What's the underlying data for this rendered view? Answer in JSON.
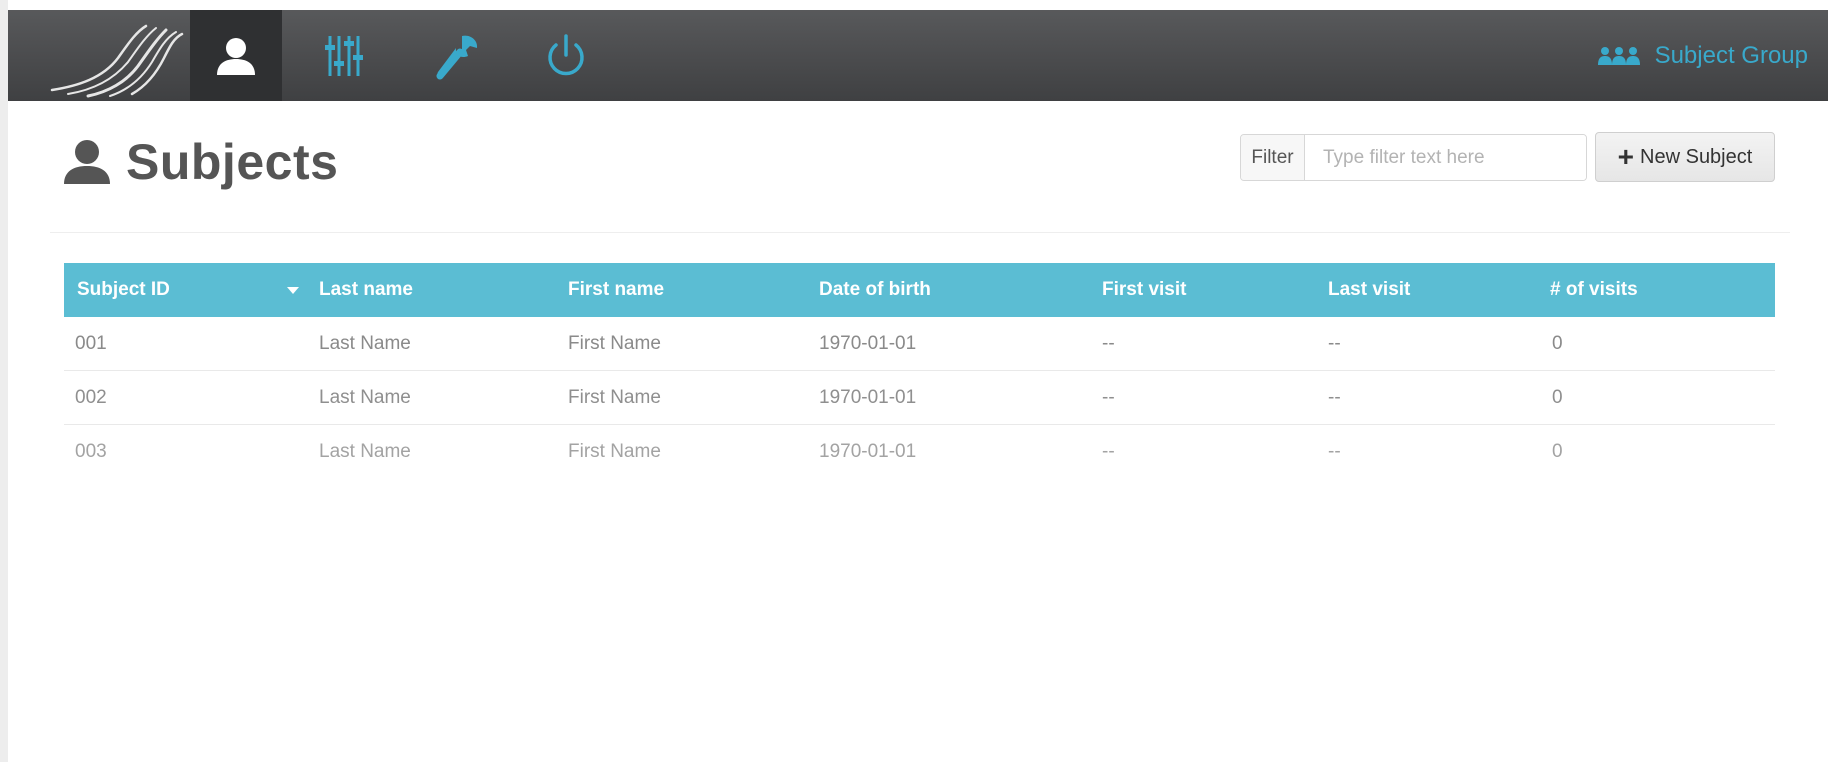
{
  "navbar": {
    "items": [
      {
        "name": "subjects",
        "icon": "user-icon",
        "active": true
      },
      {
        "name": "settings",
        "icon": "sliders-icon",
        "active": false
      },
      {
        "name": "tools",
        "icon": "wrench-icon",
        "active": false
      },
      {
        "name": "power",
        "icon": "power-icon",
        "active": false
      }
    ],
    "group_label": "Subject Group",
    "group_icon": "users-group-icon"
  },
  "page": {
    "title": "Subjects",
    "title_icon": "user-icon"
  },
  "filter": {
    "label": "Filter",
    "placeholder": "Type filter text here",
    "value": ""
  },
  "new_subject_button": {
    "plus": "+",
    "label": "New Subject"
  },
  "table": {
    "sorted_column": "Subject ID",
    "sort_direction": "descending",
    "columns": [
      "Subject ID",
      "Last name",
      "First name",
      "Date of birth",
      "First visit",
      "Last visit",
      "# of visits"
    ],
    "rows": [
      [
        "001",
        "Last Name",
        "First Name",
        "1970-01-01",
        "--",
        "--",
        "0"
      ],
      [
        "002",
        "Last Name",
        "First Name",
        "1970-01-01",
        "--",
        "--",
        "0"
      ],
      [
        "003",
        "Last Name",
        "First Name",
        "1970-01-01",
        "--",
        "--",
        "0"
      ]
    ]
  },
  "colors": {
    "navbar": "#4a4b4d",
    "accent": "#39a9cb",
    "table_header": "#5bbdd3",
    "title": "#555555"
  }
}
